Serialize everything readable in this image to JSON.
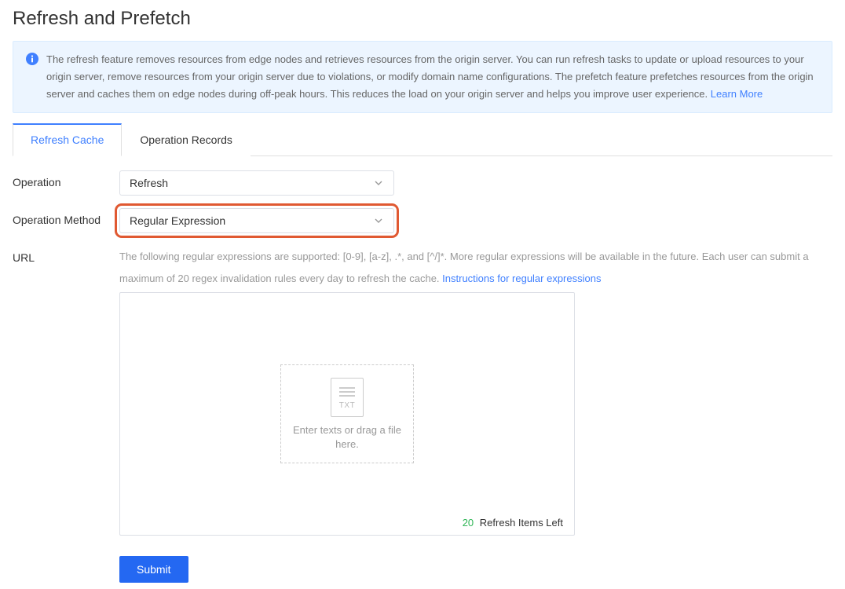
{
  "page": {
    "title": "Refresh and Prefetch"
  },
  "banner": {
    "text": "The refresh feature removes resources from edge nodes and retrieves resources from the origin server. You can run refresh tasks to update or upload resources to your origin server, remove resources from your origin server due to violations, or modify domain name configurations. The prefetch feature prefetches resources from the origin server and caches them on edge nodes during off-peak hours. This reduces the load on your origin server and helps you improve user experience. ",
    "learn_more": "Learn More"
  },
  "tabs": {
    "refresh_cache": "Refresh Cache",
    "operation_records": "Operation Records"
  },
  "form": {
    "operation_label": "Operation",
    "operation_value": "Refresh",
    "operation_method_label": "Operation Method",
    "operation_method_value": "Regular Expression",
    "url_label": "URL"
  },
  "url_help": {
    "text": "The following regular expressions are supported: [0-9], [a-z], .*, and [^/]*. More regular expressions will be available in the future. Each user can submit a maximum of 20 regex invalidation rules every day to refresh the cache.  ",
    "link": "Instructions for regular expressions"
  },
  "dropzone": {
    "file_ext": "TXT",
    "placeholder": "Enter texts or drag a file here.",
    "count": "20",
    "remaining_label": "Refresh Items Left"
  },
  "buttons": {
    "submit": "Submit"
  }
}
